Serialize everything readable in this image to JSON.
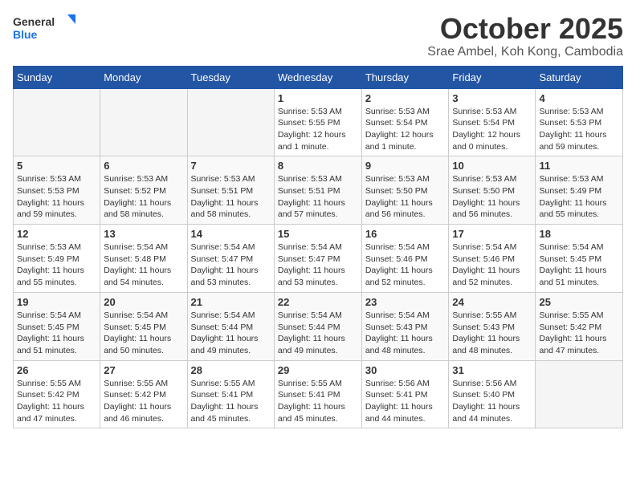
{
  "logo": {
    "line1": "General",
    "line2": "Blue"
  },
  "title": "October 2025",
  "subtitle": "Srae Ambel, Koh Kong, Cambodia",
  "weekdays": [
    "Sunday",
    "Monday",
    "Tuesday",
    "Wednesday",
    "Thursday",
    "Friday",
    "Saturday"
  ],
  "weeks": [
    [
      {
        "day": "",
        "info": ""
      },
      {
        "day": "",
        "info": ""
      },
      {
        "day": "",
        "info": ""
      },
      {
        "day": "1",
        "info": "Sunrise: 5:53 AM\nSunset: 5:55 PM\nDaylight: 12 hours\nand 1 minute."
      },
      {
        "day": "2",
        "info": "Sunrise: 5:53 AM\nSunset: 5:54 PM\nDaylight: 12 hours\nand 1 minute."
      },
      {
        "day": "3",
        "info": "Sunrise: 5:53 AM\nSunset: 5:54 PM\nDaylight: 12 hours\nand 0 minutes."
      },
      {
        "day": "4",
        "info": "Sunrise: 5:53 AM\nSunset: 5:53 PM\nDaylight: 11 hours\nand 59 minutes."
      }
    ],
    [
      {
        "day": "5",
        "info": "Sunrise: 5:53 AM\nSunset: 5:53 PM\nDaylight: 11 hours\nand 59 minutes."
      },
      {
        "day": "6",
        "info": "Sunrise: 5:53 AM\nSunset: 5:52 PM\nDaylight: 11 hours\nand 58 minutes."
      },
      {
        "day": "7",
        "info": "Sunrise: 5:53 AM\nSunset: 5:51 PM\nDaylight: 11 hours\nand 58 minutes."
      },
      {
        "day": "8",
        "info": "Sunrise: 5:53 AM\nSunset: 5:51 PM\nDaylight: 11 hours\nand 57 minutes."
      },
      {
        "day": "9",
        "info": "Sunrise: 5:53 AM\nSunset: 5:50 PM\nDaylight: 11 hours\nand 56 minutes."
      },
      {
        "day": "10",
        "info": "Sunrise: 5:53 AM\nSunset: 5:50 PM\nDaylight: 11 hours\nand 56 minutes."
      },
      {
        "day": "11",
        "info": "Sunrise: 5:53 AM\nSunset: 5:49 PM\nDaylight: 11 hours\nand 55 minutes."
      }
    ],
    [
      {
        "day": "12",
        "info": "Sunrise: 5:53 AM\nSunset: 5:49 PM\nDaylight: 11 hours\nand 55 minutes."
      },
      {
        "day": "13",
        "info": "Sunrise: 5:54 AM\nSunset: 5:48 PM\nDaylight: 11 hours\nand 54 minutes."
      },
      {
        "day": "14",
        "info": "Sunrise: 5:54 AM\nSunset: 5:47 PM\nDaylight: 11 hours\nand 53 minutes."
      },
      {
        "day": "15",
        "info": "Sunrise: 5:54 AM\nSunset: 5:47 PM\nDaylight: 11 hours\nand 53 minutes."
      },
      {
        "day": "16",
        "info": "Sunrise: 5:54 AM\nSunset: 5:46 PM\nDaylight: 11 hours\nand 52 minutes."
      },
      {
        "day": "17",
        "info": "Sunrise: 5:54 AM\nSunset: 5:46 PM\nDaylight: 11 hours\nand 52 minutes."
      },
      {
        "day": "18",
        "info": "Sunrise: 5:54 AM\nSunset: 5:45 PM\nDaylight: 11 hours\nand 51 minutes."
      }
    ],
    [
      {
        "day": "19",
        "info": "Sunrise: 5:54 AM\nSunset: 5:45 PM\nDaylight: 11 hours\nand 51 minutes."
      },
      {
        "day": "20",
        "info": "Sunrise: 5:54 AM\nSunset: 5:45 PM\nDaylight: 11 hours\nand 50 minutes."
      },
      {
        "day": "21",
        "info": "Sunrise: 5:54 AM\nSunset: 5:44 PM\nDaylight: 11 hours\nand 49 minutes."
      },
      {
        "day": "22",
        "info": "Sunrise: 5:54 AM\nSunset: 5:44 PM\nDaylight: 11 hours\nand 49 minutes."
      },
      {
        "day": "23",
        "info": "Sunrise: 5:54 AM\nSunset: 5:43 PM\nDaylight: 11 hours\nand 48 minutes."
      },
      {
        "day": "24",
        "info": "Sunrise: 5:55 AM\nSunset: 5:43 PM\nDaylight: 11 hours\nand 48 minutes."
      },
      {
        "day": "25",
        "info": "Sunrise: 5:55 AM\nSunset: 5:42 PM\nDaylight: 11 hours\nand 47 minutes."
      }
    ],
    [
      {
        "day": "26",
        "info": "Sunrise: 5:55 AM\nSunset: 5:42 PM\nDaylight: 11 hours\nand 47 minutes."
      },
      {
        "day": "27",
        "info": "Sunrise: 5:55 AM\nSunset: 5:42 PM\nDaylight: 11 hours\nand 46 minutes."
      },
      {
        "day": "28",
        "info": "Sunrise: 5:55 AM\nSunset: 5:41 PM\nDaylight: 11 hours\nand 45 minutes."
      },
      {
        "day": "29",
        "info": "Sunrise: 5:55 AM\nSunset: 5:41 PM\nDaylight: 11 hours\nand 45 minutes."
      },
      {
        "day": "30",
        "info": "Sunrise: 5:56 AM\nSunset: 5:41 PM\nDaylight: 11 hours\nand 44 minutes."
      },
      {
        "day": "31",
        "info": "Sunrise: 5:56 AM\nSunset: 5:40 PM\nDaylight: 11 hours\nand 44 minutes."
      },
      {
        "day": "",
        "info": ""
      }
    ]
  ]
}
